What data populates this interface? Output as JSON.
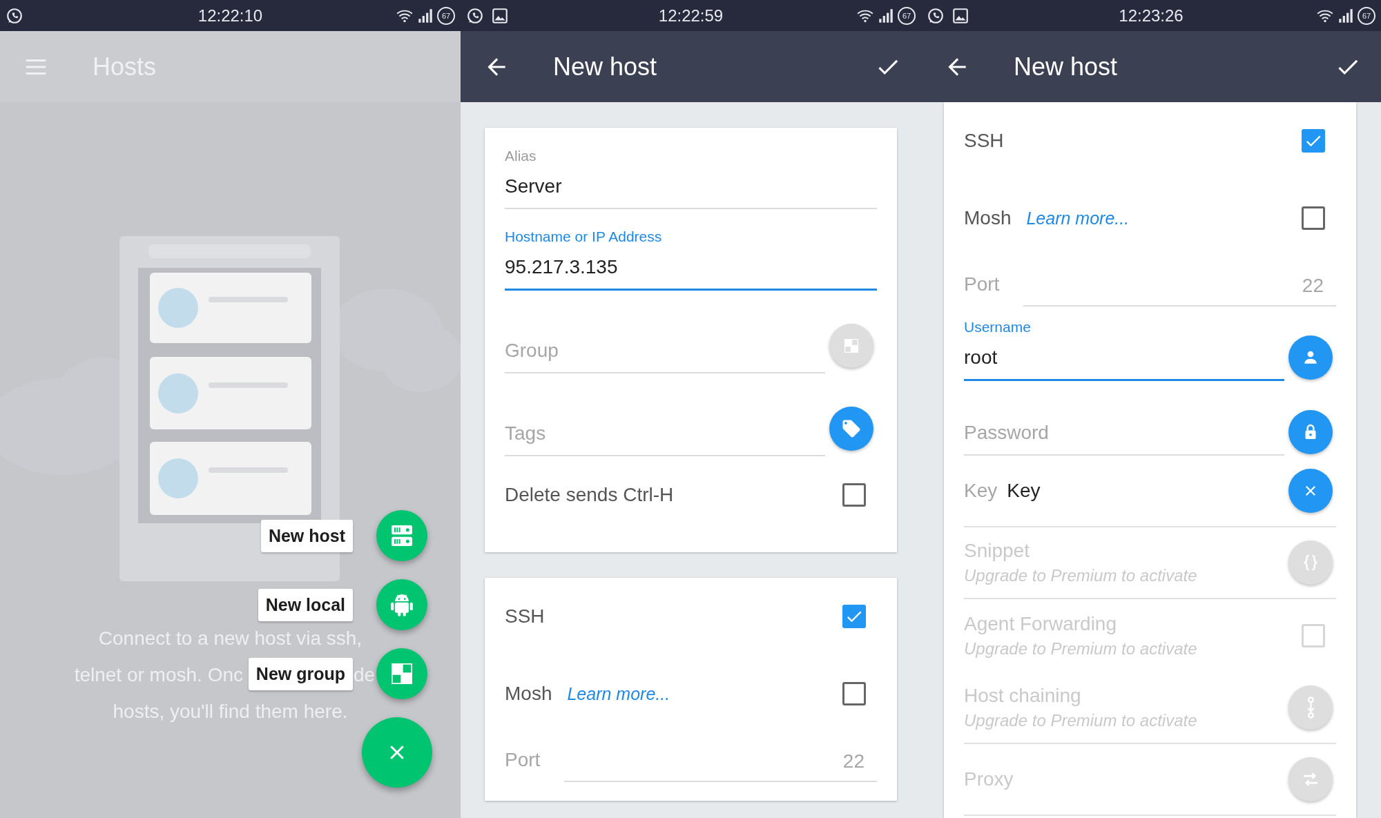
{
  "screens": [
    {
      "kind": "hosts",
      "status_bar": {
        "notifications": [
          {
            "kind": "chat"
          }
        ],
        "time": "12:22:10",
        "battery": "67"
      },
      "toolbar": {
        "title": "Hosts",
        "dimmed": true,
        "nav": {
          "kind": "menu"
        }
      },
      "empty_message": [
        [
          "Connect to a new host via ssh,"
        ],
        [
          "telnet or mosh. Onc",
          "de"
        ],
        [
          "hosts, you'll find them here."
        ]
      ],
      "fab_menu": [
        {
          "label": "New host",
          "kind": "host"
        },
        {
          "label": "New local",
          "kind": "local"
        },
        {
          "label": "New group",
          "kind": "group"
        }
      ]
    },
    {
      "kind": "form",
      "status_bar": {
        "notifications": [
          {
            "kind": "chat"
          },
          {
            "kind": "image"
          }
        ],
        "time": "12:22:59",
        "battery": "67"
      },
      "toolbar": {
        "title": "New host",
        "dimmed": false,
        "nav": {
          "kind": "back"
        },
        "confirm": true
      },
      "cards": [
        {
          "fields": [
            {
              "kind": "text",
              "label": "Alias",
              "value": "Server",
              "focused": false
            },
            {
              "kind": "text",
              "label": "Hostname or IP Address",
              "value": "95.217.3.135",
              "focused": true
            },
            {
              "kind": "picker",
              "placeholder": "Group",
              "action": {
                "kind": "group"
              },
              "active": false
            },
            {
              "kind": "picker",
              "placeholder": "Tags",
              "action": {
                "kind": "tag"
              },
              "active": true
            },
            {
              "kind": "check",
              "label": "Delete sends Ctrl-H",
              "checked": false,
              "disabled": false
            }
          ]
        },
        {
          "fields": [
            {
              "kind": "check",
              "label": "SSH",
              "checked": true,
              "disabled": false
            },
            {
              "kind": "check",
              "label": "Mosh",
              "link": "Learn more...",
              "checked": false,
              "disabled": false
            },
            {
              "kind": "port",
              "label": "Port",
              "placeholder": "22"
            }
          ]
        }
      ]
    },
    {
      "kind": "form",
      "status_bar": {
        "notifications": [
          {
            "kind": "chat"
          },
          {
            "kind": "image"
          }
        ],
        "time": "12:23:26",
        "battery": "67"
      },
      "toolbar": {
        "title": "New host",
        "dimmed": false,
        "nav": {
          "kind": "back"
        },
        "confirm": true
      },
      "cards": [
        {
          "fields": [
            {
              "kind": "check",
              "label": "SSH",
              "checked": true,
              "disabled": false
            },
            {
              "kind": "check",
              "label": "Mosh",
              "link": "Learn more...",
              "checked": false,
              "disabled": false
            },
            {
              "kind": "port",
              "label": "Port",
              "placeholder": "22"
            },
            {
              "kind": "text",
              "label": "Username",
              "value": "root",
              "focused": true,
              "action": {
                "kind": "person"
              }
            },
            {
              "kind": "text",
              "placeholder": "Password",
              "focused": false,
              "action": {
                "kind": "lock"
              }
            },
            {
              "kind": "inline",
              "label": "Key",
              "value": "Key",
              "action": {
                "kind": "clear"
              }
            },
            {
              "kind": "premium",
              "label": "Snippet",
              "note": "Upgrade to Premium to activate",
              "action": {
                "kind": "braces"
              },
              "disabled": true
            },
            {
              "kind": "check",
              "label": "Agent Forwarding",
              "note": "Upgrade to Premium to activate",
              "checked": false,
              "disabled": true
            },
            {
              "kind": "premium",
              "label": "Host chaining",
              "note": "Upgrade to Premium to activate",
              "action": {
                "kind": "chain"
              },
              "disabled": true
            },
            {
              "kind": "premium",
              "label": "Proxy",
              "action": {
                "kind": "swap"
              },
              "disabled": true
            }
          ]
        }
      ]
    }
  ]
}
